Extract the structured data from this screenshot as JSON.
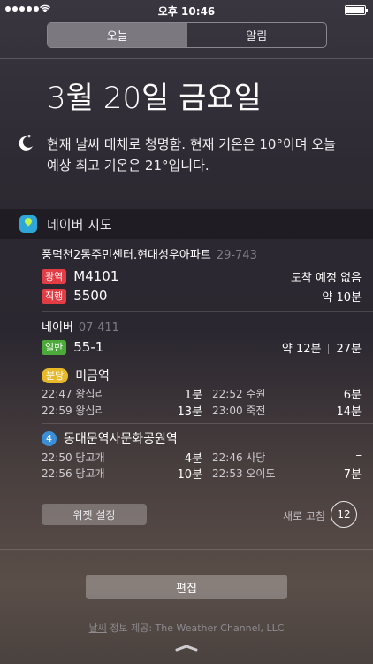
{
  "status_bar": {
    "time": "오후 10:46"
  },
  "tabs": [
    {
      "label": "오늘",
      "active": true
    },
    {
      "label": "알림",
      "active": false
    }
  ],
  "today": {
    "date": "3월 20일 금요일",
    "weather_line1": "현재 날씨 대체로 청명함. 현재 기온은 10°이며 오늘",
    "weather_line2": "예상 최고 기온은 21°입니다."
  },
  "widget": {
    "title": "네이버 지도",
    "stop1": {
      "name": "풍덕천2동주민센터.현대성우아파트",
      "id": "29-743",
      "routes": [
        {
          "badge": "광역",
          "color": "#e23c44",
          "route": "M4101",
          "eta": "도착 예정 없음"
        },
        {
          "badge": "직행",
          "color": "#e23c44",
          "route": "5500",
          "eta": "약 10분"
        }
      ]
    },
    "stop2": {
      "name": "네이버",
      "id": "07-411",
      "route": {
        "badge": "일반",
        "color": "#4caa3a",
        "route": "55-1",
        "eta1": "약 12분",
        "eta2": "27분"
      }
    },
    "station1": {
      "badge": "분당",
      "name": "미금역",
      "left": [
        {
          "time": "22:47 왕십리",
          "min": "1분"
        },
        {
          "time": "22:59 왕십리",
          "min": "13분"
        }
      ],
      "right": [
        {
          "time": "22:52 수원",
          "min": "6분"
        },
        {
          "time": "23:00 죽전",
          "min": "14분"
        }
      ]
    },
    "station2": {
      "badge": "4",
      "name": "동대문역사문화공원역",
      "left": [
        {
          "time": "22:50 당고개",
          "min": "4분"
        },
        {
          "time": "22:56 당고개",
          "min": "10분"
        }
      ],
      "right": [
        {
          "time": "22:46 사당",
          "min": "–"
        },
        {
          "time": "22:53 오이도",
          "min": "7분"
        }
      ]
    },
    "settings_label": "위젯 설정",
    "refresh_label": "새로 고침",
    "refresh_count": "12"
  },
  "edit_label": "편집",
  "credit_prefix": "날씨",
  "credit_text": " 정보 제공: The Weather Channel, LLC"
}
